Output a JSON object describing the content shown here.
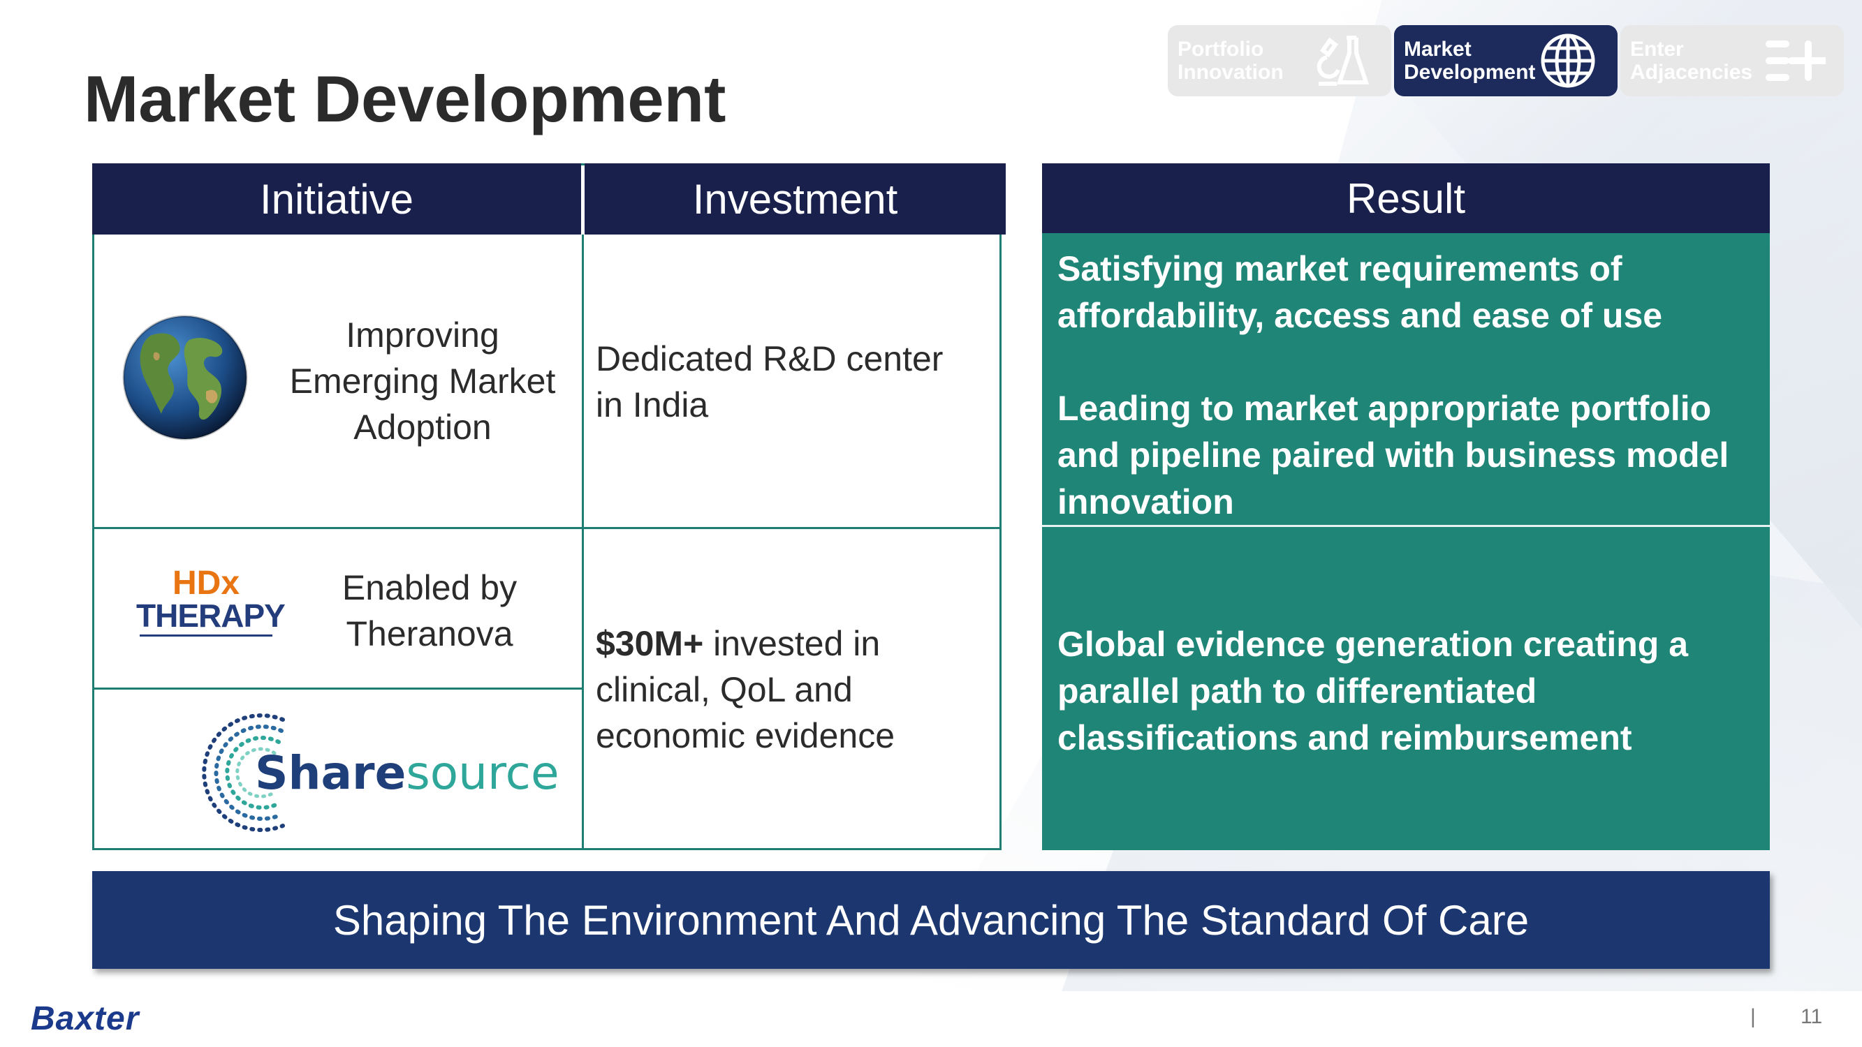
{
  "slide": {
    "title": "Market Development",
    "page_number": "11",
    "separator": "|",
    "logo_text": "Baxter"
  },
  "nav": [
    {
      "label_line1": "Portfolio",
      "label_line2": "Innovation",
      "icon": "lab-flask-icon",
      "active": false
    },
    {
      "label_line1": "Market",
      "label_line2": "Development",
      "icon": "globe-icon",
      "active": true
    },
    {
      "label_line1": "Enter",
      "label_line2": "Adjacencies",
      "icon": "list-plus-icon",
      "active": false
    }
  ],
  "table": {
    "headers": {
      "initiative": "Initiative",
      "investment": "Investment"
    },
    "row1": {
      "initiative_lines": [
        "Improving",
        "Emerging Market",
        "Adoption"
      ],
      "investment_lines": [
        "Dedicated R&D center",
        "in India"
      ]
    },
    "row2": {
      "logo_top": "HDx",
      "logo_bottom": "THERAPY",
      "initiative_lines": [
        "Enabled by",
        "Theranova"
      ]
    },
    "row3": {
      "logo_strong": "Share",
      "logo_light": "source"
    },
    "investment2": {
      "bold": "$30M+",
      "rest_line1": " invested in",
      "line2": "clinical, QoL and",
      "line3": "economic evidence"
    }
  },
  "result": {
    "header": "Result",
    "r1_lines": [
      "Satisfying market requirements of",
      "affordability, access and ease of use"
    ],
    "r2_lines": [
      "Leading to market appropriate portfolio",
      "and pipeline paired with business model",
      "innovation"
    ],
    "r3_lines": [
      "Global evidence generation creating a",
      "parallel path to differentiated",
      "classifications and reimbursement"
    ]
  },
  "banner": "Shaping The Environment And Advancing The Standard Of Care",
  "colors": {
    "navy": "#19204c",
    "teal": "#1f8577",
    "banner": "#1c3770",
    "orange": "#e87511"
  }
}
